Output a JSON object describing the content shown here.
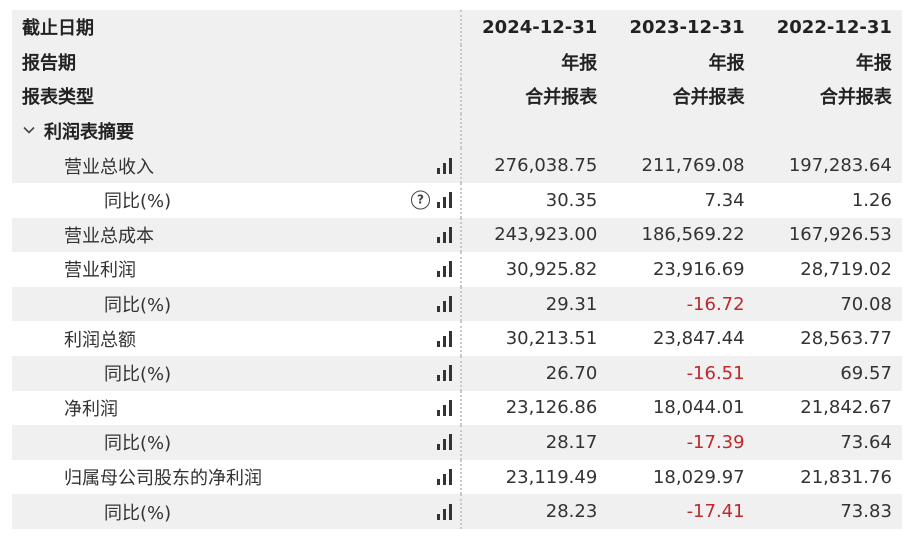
{
  "header": {
    "rows": [
      {
        "label": "截止日期",
        "values": [
          "2024-12-31",
          "2023-12-31",
          "2022-12-31"
        ]
      },
      {
        "label": "报告期",
        "values": [
          "年报",
          "年报",
          "年报"
        ]
      },
      {
        "label": "报表类型",
        "values": [
          "合并报表",
          "合并报表",
          "合并报表"
        ]
      }
    ]
  },
  "section": {
    "label": "利润表摘要",
    "icon": "chevron-down-icon"
  },
  "rows": [
    {
      "label": "营业总收入",
      "values": [
        "276,038.75",
        "211,769.08",
        "197,283.64"
      ],
      "neg": [
        false,
        false,
        false
      ]
    },
    {
      "label": "同比(%)",
      "values": [
        "30.35",
        "7.34",
        "1.26"
      ],
      "neg": [
        false,
        false,
        false
      ],
      "help": "?"
    },
    {
      "label": "营业总成本",
      "values": [
        "243,923.00",
        "186,569.22",
        "167,926.53"
      ],
      "neg": [
        false,
        false,
        false
      ]
    },
    {
      "label": "营业利润",
      "values": [
        "30,925.82",
        "23,916.69",
        "28,719.02"
      ],
      "neg": [
        false,
        false,
        false
      ]
    },
    {
      "label": "同比(%)",
      "values": [
        "29.31",
        "-16.72",
        "70.08"
      ],
      "neg": [
        false,
        true,
        false
      ]
    },
    {
      "label": "利润总额",
      "values": [
        "30,213.51",
        "23,847.44",
        "28,563.77"
      ],
      "neg": [
        false,
        false,
        false
      ]
    },
    {
      "label": "同比(%)",
      "values": [
        "26.70",
        "-16.51",
        "69.57"
      ],
      "neg": [
        false,
        true,
        false
      ]
    },
    {
      "label": "净利润",
      "values": [
        "23,126.86",
        "18,044.01",
        "21,842.67"
      ],
      "neg": [
        false,
        false,
        false
      ]
    },
    {
      "label": "同比(%)",
      "values": [
        "28.17",
        "-17.39",
        "73.64"
      ],
      "neg": [
        false,
        true,
        false
      ]
    },
    {
      "label": "归属母公司股东的净利润",
      "values": [
        "23,119.49",
        "18,029.97",
        "21,831.76"
      ],
      "neg": [
        false,
        false,
        false
      ]
    },
    {
      "label": "同比(%)",
      "values": [
        "28.23",
        "-17.41",
        "73.83"
      ],
      "neg": [
        false,
        true,
        false
      ]
    }
  ],
  "colors": {
    "negative": "#c0282d",
    "row_shade": "#f0f0f0"
  }
}
